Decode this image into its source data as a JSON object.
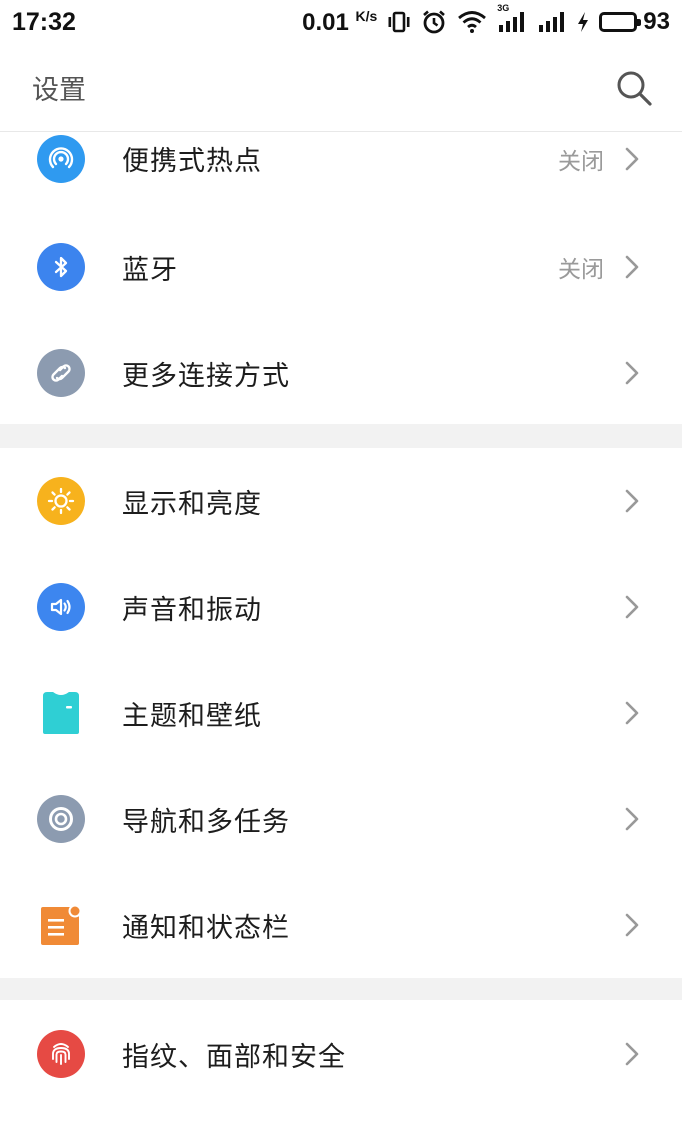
{
  "status_bar": {
    "time": "17:32",
    "speed": "0.01",
    "speed_unit": "K/s",
    "network_label": "3G",
    "battery_level": "93",
    "battery_percent": 93
  },
  "header": {
    "title": "设置"
  },
  "groups": [
    {
      "items": [
        {
          "label": "便携式热点",
          "value": "关闭",
          "icon": "hotspot-icon",
          "color": "#2f9af0"
        },
        {
          "label": "蓝牙",
          "value": "关闭",
          "icon": "bluetooth-icon",
          "color": "#3c84ee"
        },
        {
          "label": "更多连接方式",
          "icon": "link-icon",
          "color": "#8c9bb0"
        }
      ]
    },
    {
      "items": [
        {
          "label": "显示和亮度",
          "icon": "sun-icon",
          "color": "#f7b21d"
        },
        {
          "label": "声音和振动",
          "icon": "speaker-icon",
          "color": "#3d86ef"
        },
        {
          "label": "主题和壁纸",
          "icon": "shirt-icon",
          "color": "#2fcfd4"
        },
        {
          "label": "导航和多任务",
          "icon": "navigation-icon",
          "color": "#8c9bb0"
        },
        {
          "label": "通知和状态栏",
          "icon": "notification-icon",
          "color": "#f08a36"
        }
      ]
    },
    {
      "items": [
        {
          "label": "指纹、面部和安全",
          "icon": "fingerprint-icon",
          "color": "#e64a44"
        }
      ]
    }
  ]
}
